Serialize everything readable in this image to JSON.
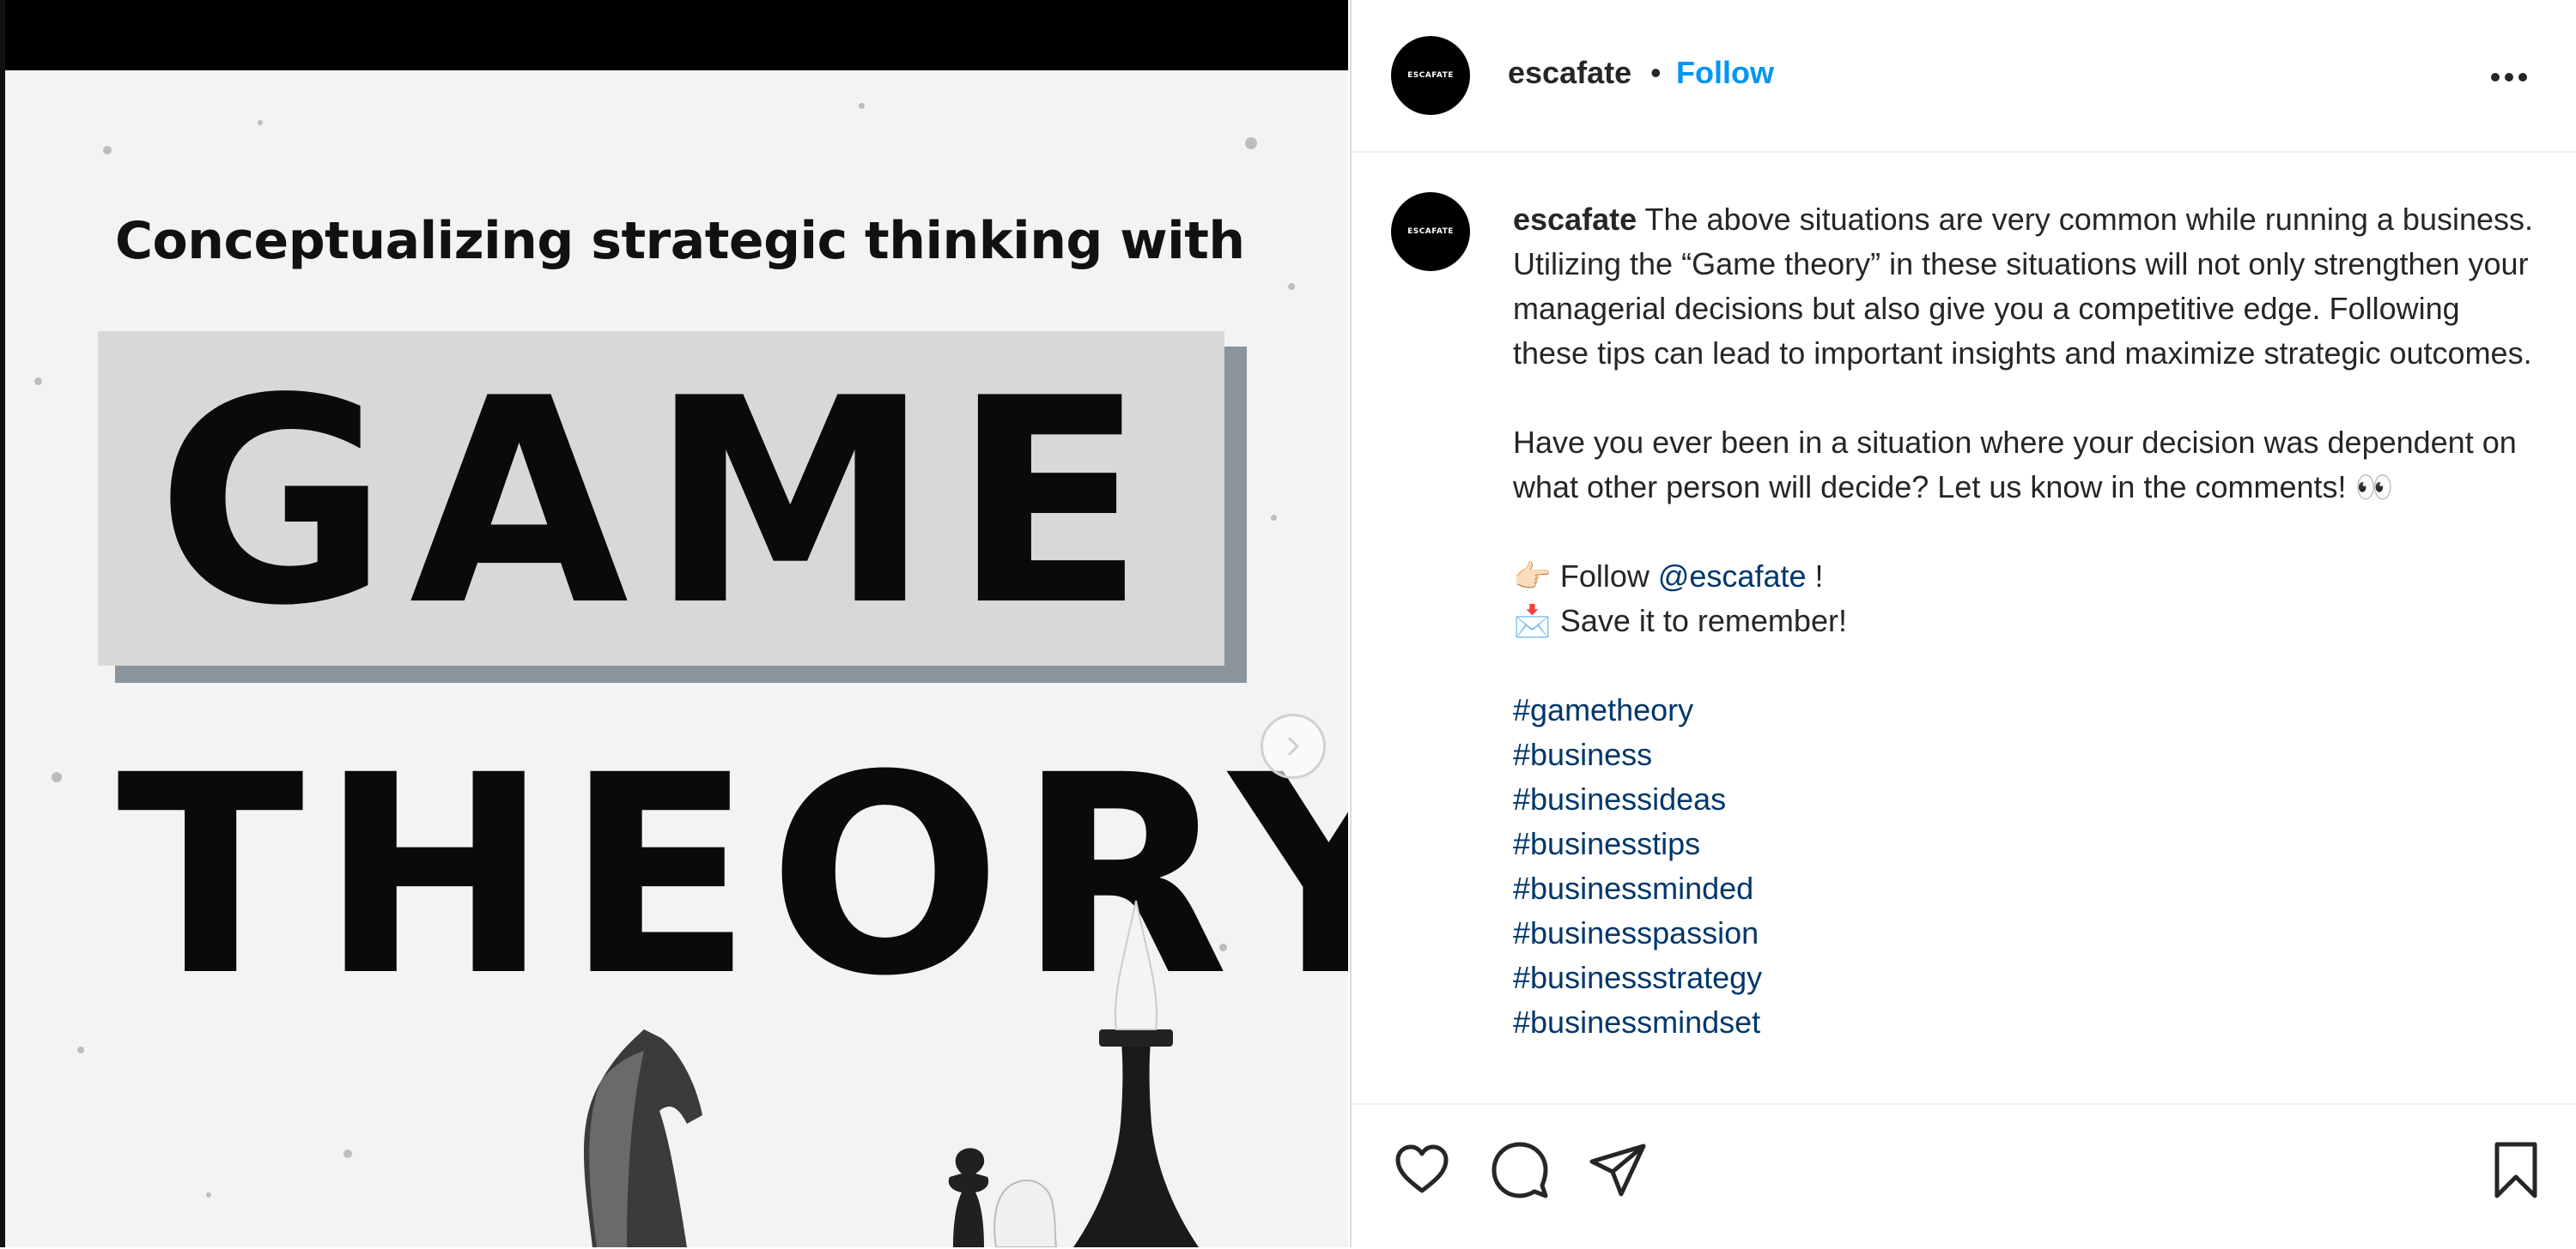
{
  "post_image": {
    "headline": "Conceptualizing strategic thinking with",
    "title_line1": "GAME",
    "title_line2": "THEORY"
  },
  "header": {
    "avatar_text": "ESCAFATE",
    "username": "escafate",
    "separator": "•",
    "follow_label": "Follow"
  },
  "caption": {
    "avatar_text": "ESCAFATE",
    "username": "escafate",
    "paragraph1": "The above situations are very common while running a business. Utilizing the “Game theory” in these situations will not only strengthen your managerial decisions but also give you a competitive edge. Following these tips can lead to important insights and maximize strategic outcomes.",
    "paragraph2": "Have you ever been in a situation where your decision was dependent on what other person will decide? Let us know in the comments! 👀",
    "follow_prefix": "👉🏻 Follow ",
    "follow_mention": "@escafate",
    "follow_suffix": " !",
    "save_line": "📩  Save it to remember!",
    "hashtags": [
      "#gametheory",
      "#business",
      "#businessideas",
      "#businesstips",
      "#businessminded",
      "#businesspassion",
      "#businessstrategy",
      "#businessmindset"
    ]
  },
  "icons": {
    "more": "more-options-icon",
    "like": "heart-icon",
    "comment": "comment-icon",
    "share": "paper-plane-icon",
    "save": "bookmark-icon",
    "next": "chevron-right-icon"
  },
  "colors": {
    "link": "#00376b",
    "follow": "#0095f6",
    "text": "#262626"
  }
}
